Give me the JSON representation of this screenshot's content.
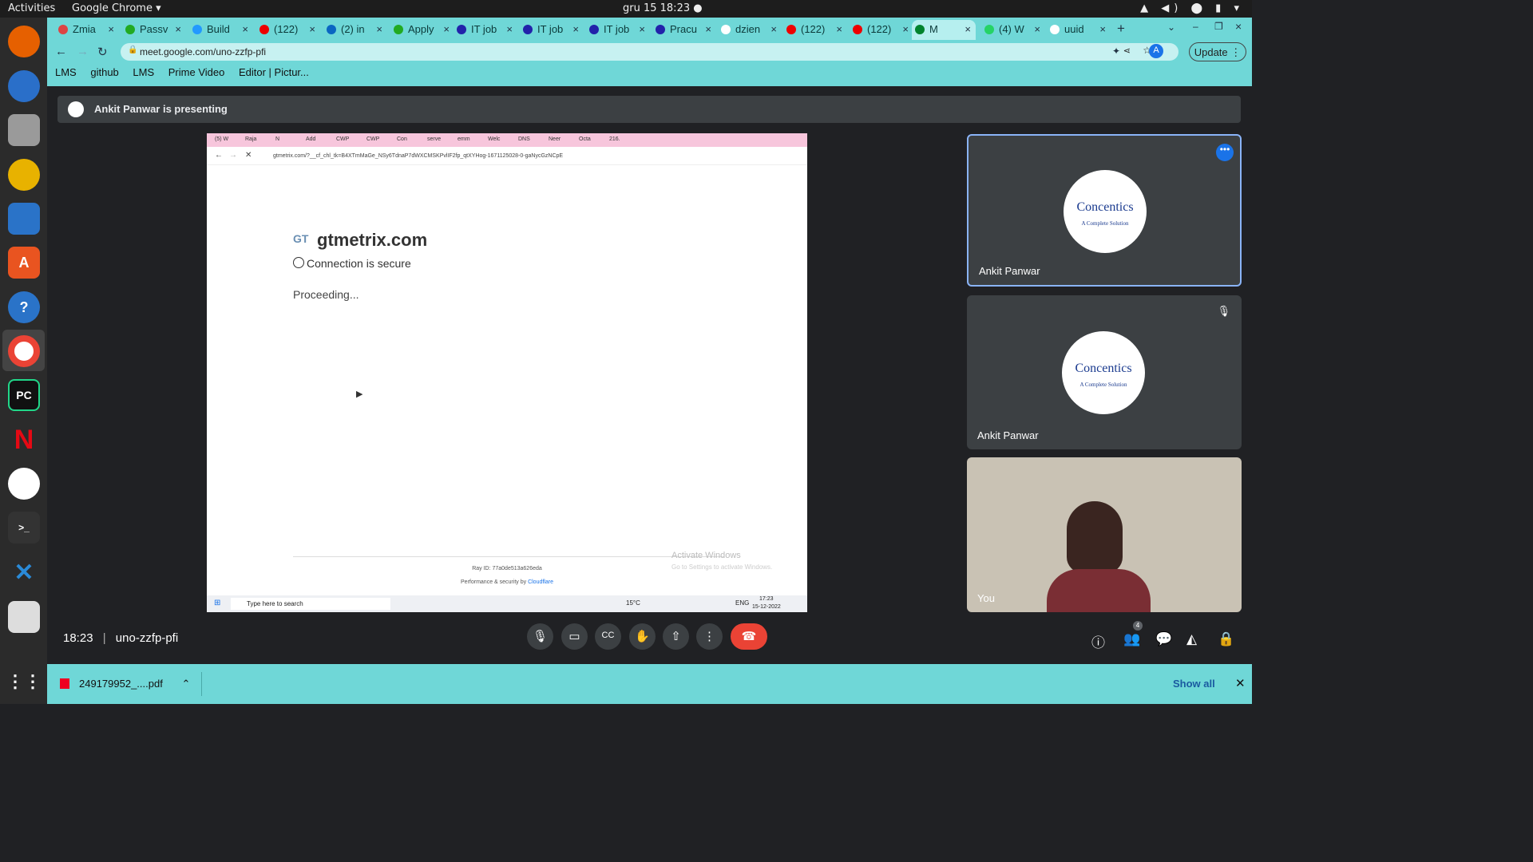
{
  "system": {
    "activities": "Activities",
    "app": "Google Chrome ▾",
    "clock": "gru 15  18:23  ●",
    "tray": "▲ ◀) ⬤ ▮ ▾"
  },
  "browser": {
    "tabs": [
      "Zmia",
      "Passv",
      "Build",
      "(122)",
      "(2) in",
      "Apply",
      "IT job",
      "IT job",
      "IT job",
      "Pracu",
      "dzien",
      "(122)",
      "(122)",
      "M",
      "(4) W",
      "uuid"
    ],
    "url": "meet.google.com/uno-zzfp-pfi",
    "update_label": "Update",
    "bookmarks": [
      "LMS",
      "github",
      "LMS",
      "Prime Video",
      "Editor | Pictur..."
    ]
  },
  "meet": {
    "presenting": "Ankit Panwar is presenting",
    "time": "18:23",
    "code": "uno-zzfp-pfi",
    "participant_count": "4",
    "tiles": [
      {
        "name": "Ankit Panwar",
        "logo": "Concentics",
        "logo_sub": "A Complete Solution"
      },
      {
        "name": "Ankit Panwar",
        "logo": "Concentics",
        "logo_sub": "A Complete Solution"
      },
      {
        "name": "You"
      }
    ]
  },
  "shared": {
    "tabs": [
      "(5) W",
      "Raja",
      "N",
      "Add",
      "CWP",
      "CWP",
      "Con",
      "serve",
      "emm",
      "Welc",
      "DNS",
      "Neer",
      "Octa",
      "216."
    ],
    "url": "gtmetrix.com/?__cf_chl_tk=B4XTmMaGe_NSy6TdnaP7dWXCMSKPvlIF2fp_qtXYHog-1671125028-0-gaNycGzNCpE",
    "gt": "GT",
    "site": "gtmetrix.com",
    "secure": "Connection is secure",
    "proceeding": "Proceeding...",
    "ray": "Ray ID: 77a0de513a626eda",
    "perf": "Performance & security by",
    "perf_link": "Cloudflare",
    "activate": "Activate Windows",
    "activate_sub": "Go to Settings to activate Windows.",
    "search": "Type here to search",
    "temp": "15°C",
    "lang": "ENG",
    "tray_time": "17:23",
    "tray_date": "15-12-2022"
  },
  "downloads": {
    "file": "249179952_....pdf",
    "show_all": "Show all"
  }
}
